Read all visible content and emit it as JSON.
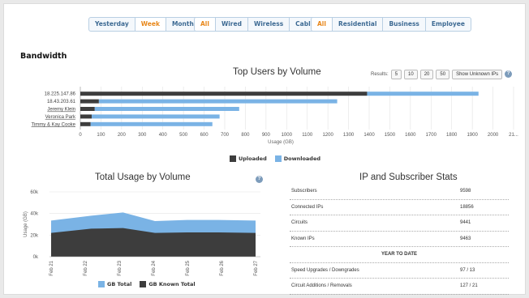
{
  "filters": {
    "period": [
      {
        "label": "Yesterday",
        "active": false
      },
      {
        "label": "Week",
        "active": true
      },
      {
        "label": "Month",
        "active": false
      }
    ],
    "connection": [
      {
        "label": "All",
        "active": true
      },
      {
        "label": "Wired",
        "active": false
      },
      {
        "label": "Wireless",
        "active": false
      },
      {
        "label": "Cable",
        "active": false
      }
    ],
    "segment": [
      {
        "label": "All",
        "active": true
      },
      {
        "label": "Residential",
        "active": false
      },
      {
        "label": "Business",
        "active": false
      },
      {
        "label": "Employee",
        "active": false
      }
    ]
  },
  "section_title": "Bandwidth",
  "top_users": {
    "title": "Top Users by Volume",
    "results_label": "Results:",
    "results_options": [
      "5",
      "10",
      "20",
      "50"
    ],
    "show_unknown": "Show Unknown IPs",
    "legend_uploaded": "Uploaded",
    "legend_downloaded": "Downloaded"
  },
  "total_usage": {
    "title": "Total Usage by Volume",
    "legend_total": "GB Total",
    "legend_known": "GB Known Total"
  },
  "stats": {
    "title": "IP and Subscriber Stats",
    "rows": [
      {
        "label": "Subscribers",
        "value": "9598"
      },
      {
        "label": "Connected IPs",
        "value": "18856"
      },
      {
        "label": "Circuits",
        "value": "9441"
      },
      {
        "label": "Known IPs",
        "value": "9463"
      }
    ],
    "ytd_label": "YEAR TO DATE",
    "ytd_rows": [
      {
        "label": "Speed Upgrades / Downgrades",
        "value": "97 / 13"
      },
      {
        "label": "Circuit Additions / Removals",
        "value": "127 / 21"
      }
    ]
  },
  "colors": {
    "uploaded": "#3d3d3d",
    "downloaded": "#7ab3e5",
    "active": "#e8881c",
    "area_total": "#7ab3e5",
    "area_known": "#3d3d3d"
  },
  "chart_data": [
    {
      "type": "bar",
      "orientation": "horizontal",
      "stacked": true,
      "title": "Top Users by Volume",
      "xlabel": "Usage (GB)",
      "xlim": [
        0,
        2100
      ],
      "x_ticks": [
        "0",
        "100",
        "200",
        "300",
        "400",
        "500",
        "600",
        "700",
        "800",
        "900",
        "1000",
        "1100",
        "1200",
        "1300",
        "1400",
        "1500",
        "1600",
        "1700",
        "1800",
        "1900",
        "2000",
        "21..."
      ],
      "categories": [
        "18.225.147.86",
        "18.43.203.61",
        "Jeremy Klein",
        "Veronica Park",
        "Timmy & Kay Cooke"
      ],
      "category_links": [
        false,
        false,
        true,
        true,
        true
      ],
      "series": [
        {
          "name": "Uploaded",
          "values": [
            1390,
            90,
            70,
            55,
            50
          ]
        },
        {
          "name": "Downloaded",
          "values": [
            540,
            1155,
            700,
            620,
            590
          ]
        }
      ],
      "grid": true,
      "legend": "bottom"
    },
    {
      "type": "area",
      "title": "Total Usage by Volume",
      "ylabel": "Usage (GB)",
      "ylim": [
        0,
        60000
      ],
      "y_ticks": [
        "0k",
        "20k",
        "40k",
        "60k"
      ],
      "categories": [
        "Feb 21",
        "Feb 22",
        "Feb 23",
        "Feb 24",
        "Feb 25",
        "Feb 26",
        "Feb 27"
      ],
      "series": [
        {
          "name": "GB Total",
          "values": [
            33500,
            38000,
            41000,
            33000,
            34000,
            34000,
            33500
          ]
        },
        {
          "name": "GB Known Total",
          "values": [
            22000,
            26000,
            26500,
            22000,
            22500,
            22500,
            22000
          ]
        }
      ],
      "grid": true,
      "legend": "bottom"
    }
  ]
}
